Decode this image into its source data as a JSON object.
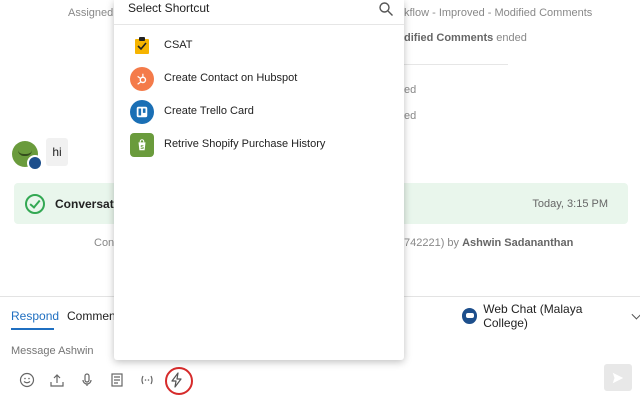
{
  "feed": {
    "sys_assigned": "Assigned t",
    "sys_workflow": "kflow - Improved - Modified Comments",
    "sys_ended_name": "dified Comments",
    "sys_ended_word": " ended",
    "sys_ed1": "ed",
    "sys_ed2": "ed",
    "bubble_text": "hi",
    "banner_title": "Conversation",
    "banner_time": "Today, 3:15 PM",
    "contact_prefix": "Cont",
    "contact_suffix": "742221) by ",
    "contact_agent": "Ashwin Sadananthan"
  },
  "composer": {
    "tab_respond": "Respond",
    "tab_comment": "Comment",
    "channel_label": "Web Chat (Malaya College)",
    "message_placeholder": "Message Ashwin"
  },
  "shortcut_dropdown": {
    "title": "Select Shortcut",
    "items": [
      {
        "label": "CSAT",
        "icon": "csat-icon"
      },
      {
        "label": "Create Contact on Hubspot",
        "icon": "hubspot-icon"
      },
      {
        "label": "Create Trello Card",
        "icon": "trello-icon"
      },
      {
        "label": "Retrive Shopify Purchase History",
        "icon": "shopify-icon"
      }
    ]
  },
  "colors": {
    "accent": "#1f6fc1",
    "banner_bg": "#e9f6ec",
    "success": "#33a853",
    "highlight_ring": "#d62b2b"
  }
}
